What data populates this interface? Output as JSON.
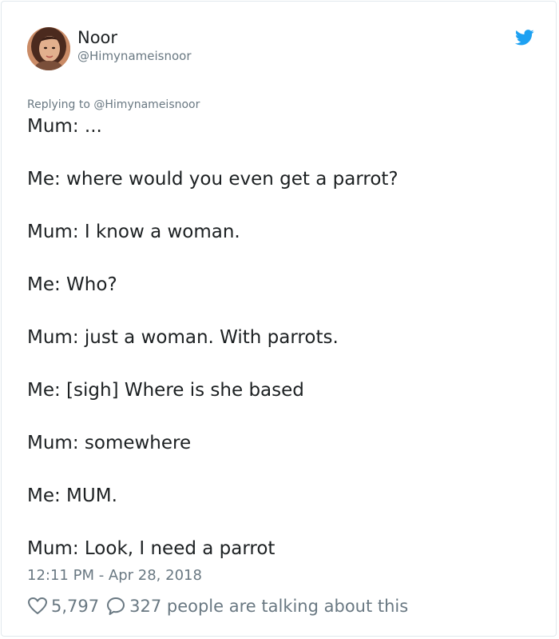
{
  "user": {
    "name": "Noor",
    "handle": "@Himynameisnoor",
    "avatar_icon": "profile-photo"
  },
  "brand": {
    "icon": "twitter-bird-icon",
    "color": "#1da1f2"
  },
  "reply": {
    "prefix": "Replying to",
    "to": "@Himynameisnoor"
  },
  "tweet": {
    "lines": [
      "Mum: ...",
      "Me: where would you even get a parrot?",
      "Mum: I know a woman.",
      "Me: Who?",
      "Mum: just a woman. With parrots.",
      "Me: [sigh] Where is she based",
      "Mum: somewhere",
      "Me: MUM.",
      "Mum: Look, I need a parrot"
    ],
    "timestamp": "12:11 PM - Apr 28, 2018"
  },
  "stats": {
    "likes": "5,797",
    "talking": "327 people are talking about this"
  },
  "colors": {
    "text": "#1c2022",
    "muted": "#697882",
    "border": "#e1e8ed"
  }
}
